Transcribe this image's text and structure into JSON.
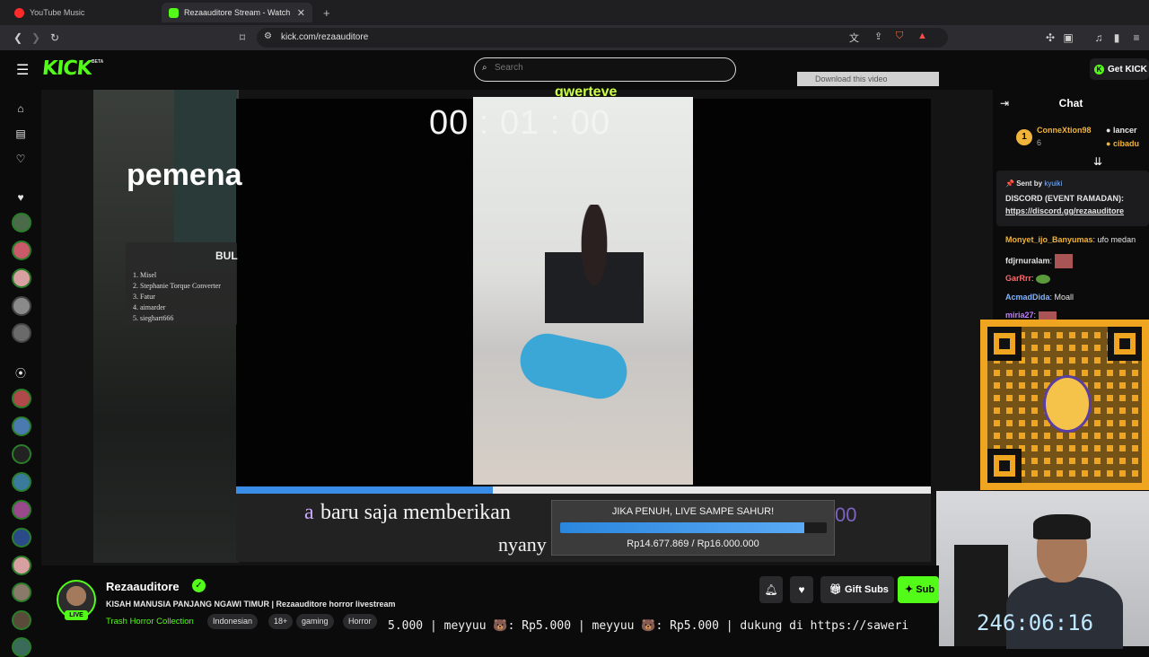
{
  "browser": {
    "tabs": [
      {
        "label": "YouTube Music"
      },
      {
        "label": "Rezaauditore Stream - Watch"
      }
    ],
    "url": "kick.com/rezaauditore",
    "new_tab_icon": "plus-icon"
  },
  "kick": {
    "logo": "KICK",
    "beta": "BETA",
    "search_placeholder": "Search",
    "get_kick": "Get KICK"
  },
  "overlay": {
    "timer": "00 : 01 : 00",
    "pemena": "pemena",
    "bul_title": "BUL",
    "bul_items": [
      "1. Misel",
      "2. Stephanie Torque Converter",
      "3. Fatur",
      "4. aimarder",
      "5. sieghart666"
    ],
    "top_text": "qwerteve",
    "download": "Download this video",
    "alert_a": "a",
    "alert_line1": "baru saja memberikan",
    "alert_line2": "nyany",
    "goal_title": "JIKA PENUH, LIVE SAMPE SAHUR!",
    "goal_amount": "Rp14.677.869 / Rp16.000.000",
    "goal_progress": 0.917,
    "top_stripe_progress": 0.37,
    "purple_num": "00"
  },
  "chat": {
    "title": "Chat",
    "top_gifter_rank": "1",
    "top_gifter_name": "ConneXtion98",
    "top_gifter_count": "6",
    "gifter2": "lancer",
    "gifter3": "cibadu",
    "pinned_sent_by": "Sent by",
    "pinned_user": "kyuiki",
    "pinned_line1": "DISCORD (EVENT RAMADAN):",
    "pinned_link": "https://discord.gg/rezaauditore",
    "messages": [
      {
        "user": "Monyet_ijo_Banyumas",
        "text": "ufo medan",
        "color": "#f0b43a"
      },
      {
        "user": "fdjrnuralam",
        "text": "",
        "color": "#e8e8e8"
      },
      {
        "user": "GarRrr",
        "text": "",
        "color": "#ff6b6b"
      },
      {
        "user": "AcmadDida",
        "text": "Moall",
        "color": "#7fb6ff"
      },
      {
        "user": "miria27",
        "text": "",
        "color": "#c07cff"
      }
    ]
  },
  "channel": {
    "name": "Rezaauditore",
    "live": "LIVE",
    "title": "KISAH MANUSIA PANJANG NGAWI TIMUR | Rezaauditore horror livestream",
    "category": "Trash Horror Collection",
    "tags": [
      "Indonesian",
      "18+",
      "gaming",
      "Horror"
    ],
    "gift_subs": "Gift Subs",
    "subscribe": "Sub"
  },
  "ticker": "5.000 | meyyuu 🐻: Rp5.000 | meyyuu 🐻: Rp5.000 |  dukung di https://saweri",
  "clock": "246:06:16"
}
